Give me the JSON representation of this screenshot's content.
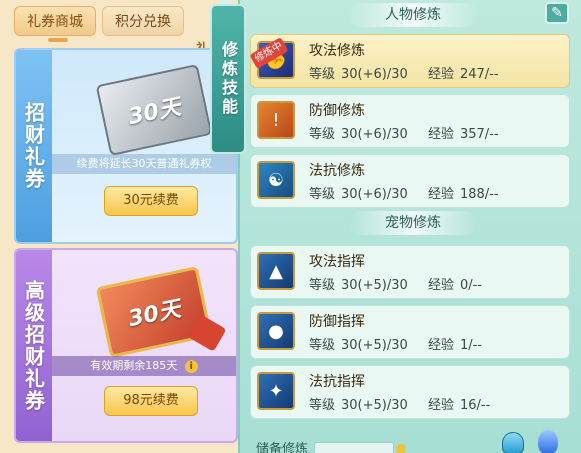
{
  "shop": {
    "tabs": [
      "礼券商城",
      "积分兑换"
    ],
    "side_char": "礼",
    "cards": [
      {
        "title": "招财礼券",
        "ticket_text": "30天",
        "info": "续费将延长30天普通礼券权",
        "button": "30元续费"
      },
      {
        "title": "高级招财礼券",
        "ticket_text": "30天",
        "info": "有效期剩余185天",
        "info_icon": "i",
        "button": "98元续费"
      }
    ]
  },
  "vertical_tab": "修炼技能",
  "panel": {
    "section_person": "人物修炼",
    "section_pet": "宠物修炼",
    "edit_icon": "✎",
    "labels": {
      "level": "等级",
      "exp": "经验"
    },
    "person_skills": [
      {
        "name": "攻法修炼",
        "level": "30(+6)/30",
        "exp": "247/--",
        "badge": "修炼中",
        "icon": "attack-magic-icon",
        "selected": true
      },
      {
        "name": "防御修炼",
        "level": "30(+6)/30",
        "exp": "357/--",
        "icon": "defense-icon"
      },
      {
        "name": "法抗修炼",
        "level": "30(+6)/30",
        "exp": "188/--",
        "icon": "magic-resist-icon"
      }
    ],
    "pet_skills": [
      {
        "name": "攻法指挥",
        "level": "30(+5)/30",
        "exp": "0/--",
        "icon": "pet-attack-icon"
      },
      {
        "name": "防御指挥",
        "level": "30(+5)/30",
        "exp": "1/--",
        "icon": "pet-defense-icon"
      },
      {
        "name": "法抗指挥",
        "level": "30(+5)/30",
        "exp": "16/--",
        "icon": "pet-resist-icon"
      }
    ],
    "reserve_label": "储备修炼"
  }
}
